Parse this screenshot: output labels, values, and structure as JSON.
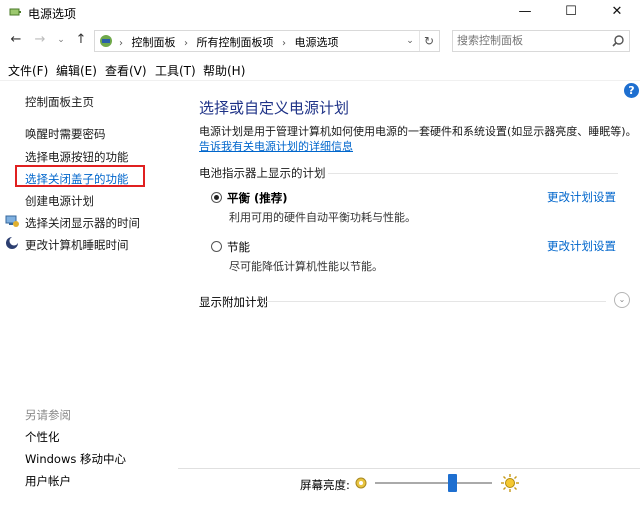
{
  "window": {
    "title": "电源选项",
    "minimize": "—",
    "maximize": "☐",
    "close": "✕"
  },
  "nav": {
    "back": "←",
    "forward": "→",
    "dropdown": "⌄",
    "up": "↑"
  },
  "address": {
    "crumbs": [
      "控制面板",
      "所有控制面板项",
      "电源选项"
    ],
    "separator": "›",
    "dropdown": "⌄",
    "refresh": "↻"
  },
  "search": {
    "placeholder": "搜索控制面板"
  },
  "menu": {
    "file": "文件(F)",
    "edit": "编辑(E)",
    "view": "查看(V)",
    "tools": "工具(T)",
    "help": "帮助(H)"
  },
  "sidebar": {
    "home": "控制面板主页",
    "items": [
      "唤醒时需要密码",
      "选择电源按钮的功能",
      "选择关闭盖子的功能",
      "创建电源计划",
      "选择关闭显示器的时间",
      "更改计算机睡眠时间"
    ],
    "see_also": "另请参阅",
    "see_also_items": [
      "个性化",
      "Windows 移动中心",
      "用户帐户"
    ]
  },
  "main": {
    "help": "?",
    "title": "选择或自定义电源计划",
    "description": "电源计划是用于管理计算机如何使用电源的一套硬件和系统设置(如显示器亮度、睡眠等)。",
    "link": "告诉我有关电源计划的详细信息",
    "section": "电池指示器上显示的计划",
    "plans": [
      {
        "name": "平衡 (推荐)",
        "desc": "利用可用的硬件自动平衡功耗与性能。",
        "selected": true,
        "change": "更改计划设置"
      },
      {
        "name": "节能",
        "desc": "尽可能降低计算机性能以节能。",
        "selected": false,
        "change": "更改计划设置"
      }
    ],
    "extra": "显示附加计划",
    "expander": "⌄"
  },
  "brightness": {
    "label": "屏幕亮度:",
    "level": 0.66
  },
  "colors": {
    "accent": "#1e6fd0",
    "link": "#0066cc",
    "title": "#1e3287",
    "highlight": "#e02020"
  }
}
